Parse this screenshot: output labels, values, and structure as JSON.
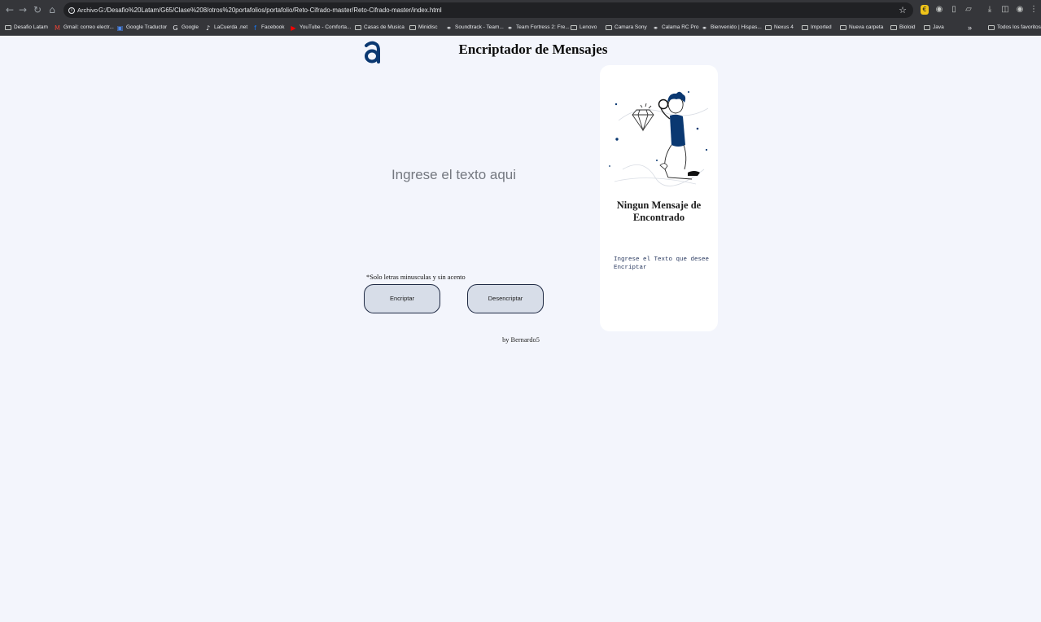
{
  "browser": {
    "address_chip": "Archivo",
    "url": "G:/Desafio%20Latam/G65/Clase%208/otros%20portafolios/portafolio/Reto-Cifrado-master/Reto-Cifrado-master/index.html",
    "bookmarks": [
      "Desafio Latam",
      "Gmail: correo electr...",
      "Google Traductor",
      "Google",
      "LaCuerda .net",
      "Facebook",
      "YouTube - Comforta...",
      "Casas de Musica",
      "Minidisc",
      "Soundtrack - Team...",
      "Team Fortress 2: Fre...",
      "Lenovo",
      "Camara Sony",
      "Calama RC Pro",
      "Bienvenido | Hispas...",
      "Nexus 4",
      "Imported",
      "Nueva carpeta",
      "Bioloid",
      "Java"
    ],
    "more_bookmarks": "»",
    "all_bookmarks": "Todos los favoritos"
  },
  "page": {
    "title": "Encriptador de Mensajes",
    "input_placeholder": "Ingrese el texto aqui",
    "hint": "*Solo letras minusculas y sin acento",
    "encrypt_label": "Encriptar",
    "decrypt_label": "Desencriptar",
    "footer": "by Bernardo5"
  },
  "result_card": {
    "title": "Ningun Mensaje de Encontrado",
    "text": "Ingrese el Texto que desee Encriptar"
  }
}
